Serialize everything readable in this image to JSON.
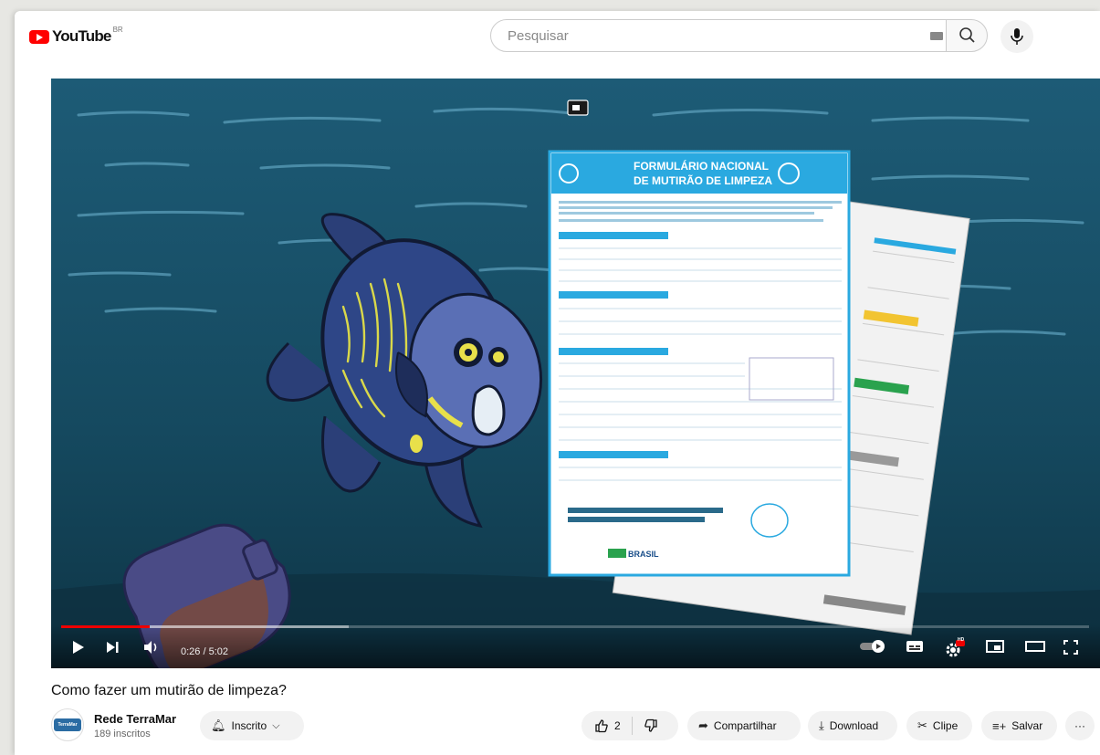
{
  "header": {
    "logo_text": "YouTube",
    "country_code": "BR",
    "search_placeholder": "Pesquisar"
  },
  "player": {
    "time_display": "0:26 / 5:02",
    "progress_fraction": 0.086,
    "notification_badge": "HD",
    "form": {
      "title_line1": "FORMULÁRIO NACIONAL",
      "title_line2": "DE MUTIRÃO DE LIMPEZA",
      "brand": "BRASIL"
    }
  },
  "video": {
    "title": "Como fazer um mutirão de limpeza?"
  },
  "channel": {
    "name": "Rede TerraMar",
    "subscribers": "189 inscritos",
    "avatar_text": "TerraMar"
  },
  "actions": {
    "subscribe_label": "Inscrito",
    "like_count": "2",
    "share_label": "Compartilhar",
    "download_label": "Download",
    "clip_label": "Clipe",
    "save_label": "Salvar",
    "more_label": "···"
  }
}
